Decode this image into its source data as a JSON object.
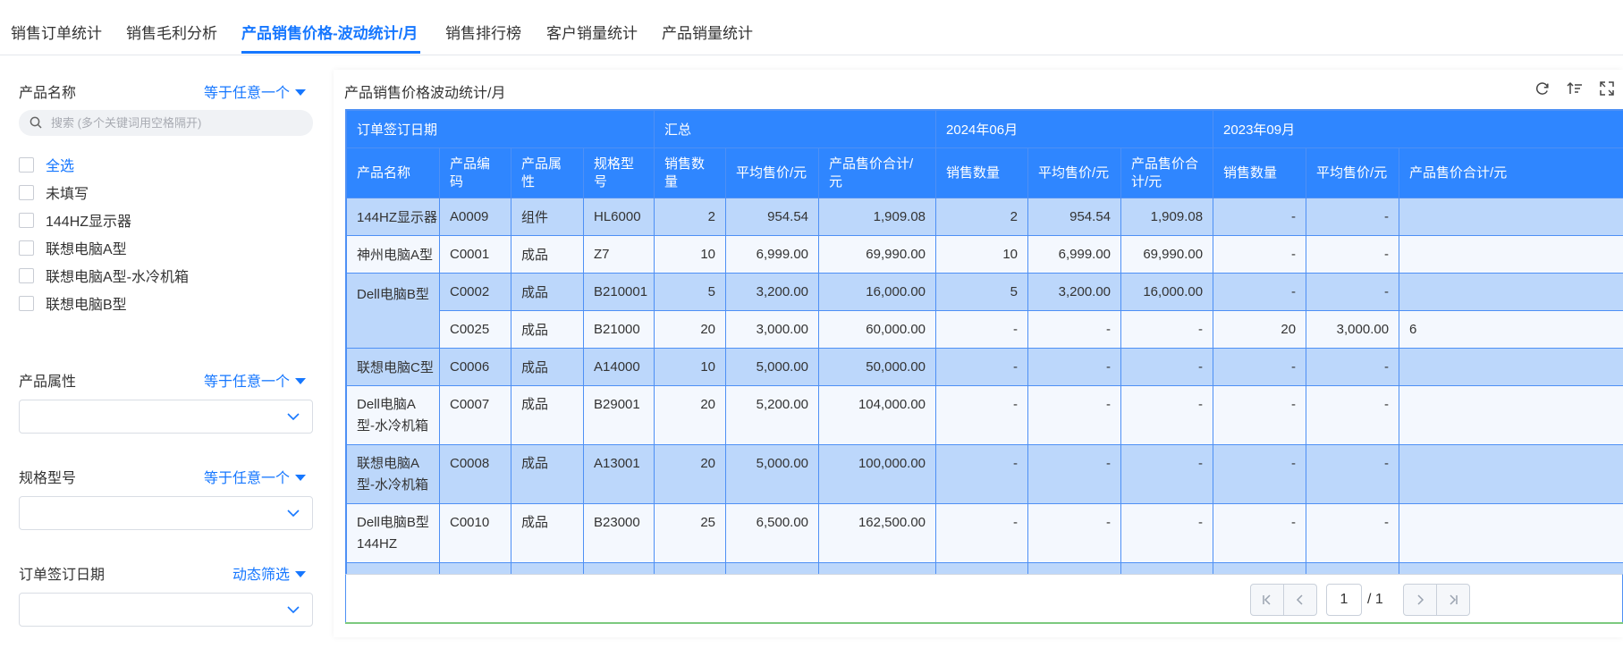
{
  "tabs": [
    {
      "label": "销售订单统计"
    },
    {
      "label": "销售毛利分析"
    },
    {
      "label": "产品销售价格-波动统计/月"
    },
    {
      "label": "销售排行榜"
    },
    {
      "label": "客户销量统计"
    },
    {
      "label": "产品销量统计"
    }
  ],
  "active_tab": "产品销售价格-波动统计/月",
  "filters": {
    "product_name": {
      "label": "产品名称",
      "mode": "等于任意一个",
      "search_placeholder": "搜索 (多个关键词用空格隔开)",
      "options": [
        "全选",
        "未填写",
        "144HZ显示器",
        "联想电脑A型",
        "联想电脑A型-水冷机箱",
        "联想电脑B型"
      ]
    },
    "product_attr": {
      "label": "产品属性",
      "mode": "等于任意一个",
      "value": ""
    },
    "spec_model": {
      "label": "规格型号",
      "mode": "等于任意一个",
      "value": ""
    },
    "order_date": {
      "label": "订单签订日期",
      "mode": "动态筛选",
      "value": ""
    }
  },
  "panel": {
    "title": "产品销售价格波动统计/月",
    "icons": [
      "refresh-icon",
      "sort-icon",
      "fullscreen-icon"
    ]
  },
  "table": {
    "group_headers": [
      "订单签订日期",
      "汇总",
      "2024年06月",
      "2023年09月"
    ],
    "columns": [
      "产品名称",
      "产品编码",
      "产品属性",
      "规格型号",
      "销售数量",
      "平均售价/元",
      "产品售价合计/元",
      "销售数量",
      "平均售价/元",
      "产品售价合计/元",
      "销售数量",
      "平均售价/元",
      "产品售价合计/元"
    ],
    "rows": [
      [
        "144HZ显示器",
        "A0009",
        "组件",
        "HL6000",
        "2",
        "954.54",
        "1,909.08",
        "2",
        "954.54",
        "1,909.08",
        "-",
        "-",
        ""
      ],
      [
        "神州电脑A型",
        "C0001",
        "成品",
        "Z7",
        "10",
        "6,999.00",
        "69,990.00",
        "10",
        "6,999.00",
        "69,990.00",
        "-",
        "-",
        ""
      ],
      [
        "Dell电脑B型",
        "C0002",
        "成品",
        "B210001",
        "5",
        "3,200.00",
        "16,000.00",
        "5",
        "3,200.00",
        "16,000.00",
        "-",
        "-",
        ""
      ],
      [
        "",
        "C0025",
        "成品",
        "B21000",
        "20",
        "3,000.00",
        "60,000.00",
        "-",
        "-",
        "-",
        "20",
        "3,000.00",
        "6"
      ],
      [
        "联想电脑C型",
        "C0006",
        "成品",
        "A14000",
        "10",
        "5,000.00",
        "50,000.00",
        "-",
        "-",
        "-",
        "-",
        "-",
        ""
      ],
      [
        "Dell电脑A型-水冷机箱",
        "C0007",
        "成品",
        "B29001",
        "20",
        "5,200.00",
        "104,000.00",
        "-",
        "-",
        "-",
        "-",
        "-",
        ""
      ],
      [
        "联想电脑A型-水冷机箱",
        "C0008",
        "成品",
        "A13001",
        "20",
        "5,000.00",
        "100,000.00",
        "-",
        "-",
        "-",
        "-",
        "-",
        ""
      ],
      [
        "Dell电脑B型144HZ",
        "C0010",
        "成品",
        "B23000",
        "25",
        "6,500.00",
        "162,500.00",
        "-",
        "-",
        "-",
        "-",
        "-",
        ""
      ]
    ]
  },
  "pager": {
    "current": "1",
    "total": "/ 1"
  },
  "colors": {
    "accent": "#1677ff",
    "header_bg": "#2f86ff",
    "row_dark": "#bcd7fb",
    "row_light": "#f4f8fe"
  }
}
